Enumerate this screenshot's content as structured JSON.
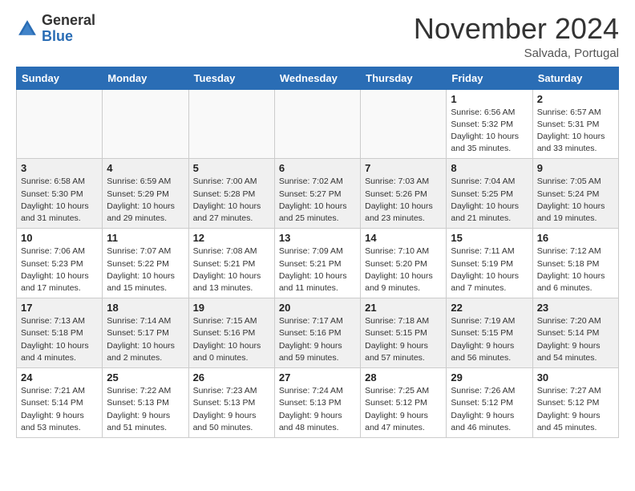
{
  "header": {
    "logo_general": "General",
    "logo_blue": "Blue",
    "month_title": "November 2024",
    "location": "Salvada, Portugal"
  },
  "weekdays": [
    "Sunday",
    "Monday",
    "Tuesday",
    "Wednesday",
    "Thursday",
    "Friday",
    "Saturday"
  ],
  "weeks": [
    [
      {
        "day": "",
        "info": ""
      },
      {
        "day": "",
        "info": ""
      },
      {
        "day": "",
        "info": ""
      },
      {
        "day": "",
        "info": ""
      },
      {
        "day": "",
        "info": ""
      },
      {
        "day": "1",
        "info": "Sunrise: 6:56 AM\nSunset: 5:32 PM\nDaylight: 10 hours\nand 35 minutes."
      },
      {
        "day": "2",
        "info": "Sunrise: 6:57 AM\nSunset: 5:31 PM\nDaylight: 10 hours\nand 33 minutes."
      }
    ],
    [
      {
        "day": "3",
        "info": "Sunrise: 6:58 AM\nSunset: 5:30 PM\nDaylight: 10 hours\nand 31 minutes."
      },
      {
        "day": "4",
        "info": "Sunrise: 6:59 AM\nSunset: 5:29 PM\nDaylight: 10 hours\nand 29 minutes."
      },
      {
        "day": "5",
        "info": "Sunrise: 7:00 AM\nSunset: 5:28 PM\nDaylight: 10 hours\nand 27 minutes."
      },
      {
        "day": "6",
        "info": "Sunrise: 7:02 AM\nSunset: 5:27 PM\nDaylight: 10 hours\nand 25 minutes."
      },
      {
        "day": "7",
        "info": "Sunrise: 7:03 AM\nSunset: 5:26 PM\nDaylight: 10 hours\nand 23 minutes."
      },
      {
        "day": "8",
        "info": "Sunrise: 7:04 AM\nSunset: 5:25 PM\nDaylight: 10 hours\nand 21 minutes."
      },
      {
        "day": "9",
        "info": "Sunrise: 7:05 AM\nSunset: 5:24 PM\nDaylight: 10 hours\nand 19 minutes."
      }
    ],
    [
      {
        "day": "10",
        "info": "Sunrise: 7:06 AM\nSunset: 5:23 PM\nDaylight: 10 hours\nand 17 minutes."
      },
      {
        "day": "11",
        "info": "Sunrise: 7:07 AM\nSunset: 5:22 PM\nDaylight: 10 hours\nand 15 minutes."
      },
      {
        "day": "12",
        "info": "Sunrise: 7:08 AM\nSunset: 5:21 PM\nDaylight: 10 hours\nand 13 minutes."
      },
      {
        "day": "13",
        "info": "Sunrise: 7:09 AM\nSunset: 5:21 PM\nDaylight: 10 hours\nand 11 minutes."
      },
      {
        "day": "14",
        "info": "Sunrise: 7:10 AM\nSunset: 5:20 PM\nDaylight: 10 hours\nand 9 minutes."
      },
      {
        "day": "15",
        "info": "Sunrise: 7:11 AM\nSunset: 5:19 PM\nDaylight: 10 hours\nand 7 minutes."
      },
      {
        "day": "16",
        "info": "Sunrise: 7:12 AM\nSunset: 5:18 PM\nDaylight: 10 hours\nand 6 minutes."
      }
    ],
    [
      {
        "day": "17",
        "info": "Sunrise: 7:13 AM\nSunset: 5:18 PM\nDaylight: 10 hours\nand 4 minutes."
      },
      {
        "day": "18",
        "info": "Sunrise: 7:14 AM\nSunset: 5:17 PM\nDaylight: 10 hours\nand 2 minutes."
      },
      {
        "day": "19",
        "info": "Sunrise: 7:15 AM\nSunset: 5:16 PM\nDaylight: 10 hours\nand 0 minutes."
      },
      {
        "day": "20",
        "info": "Sunrise: 7:17 AM\nSunset: 5:16 PM\nDaylight: 9 hours\nand 59 minutes."
      },
      {
        "day": "21",
        "info": "Sunrise: 7:18 AM\nSunset: 5:15 PM\nDaylight: 9 hours\nand 57 minutes."
      },
      {
        "day": "22",
        "info": "Sunrise: 7:19 AM\nSunset: 5:15 PM\nDaylight: 9 hours\nand 56 minutes."
      },
      {
        "day": "23",
        "info": "Sunrise: 7:20 AM\nSunset: 5:14 PM\nDaylight: 9 hours\nand 54 minutes."
      }
    ],
    [
      {
        "day": "24",
        "info": "Sunrise: 7:21 AM\nSunset: 5:14 PM\nDaylight: 9 hours\nand 53 minutes."
      },
      {
        "day": "25",
        "info": "Sunrise: 7:22 AM\nSunset: 5:13 PM\nDaylight: 9 hours\nand 51 minutes."
      },
      {
        "day": "26",
        "info": "Sunrise: 7:23 AM\nSunset: 5:13 PM\nDaylight: 9 hours\nand 50 minutes."
      },
      {
        "day": "27",
        "info": "Sunrise: 7:24 AM\nSunset: 5:13 PM\nDaylight: 9 hours\nand 48 minutes."
      },
      {
        "day": "28",
        "info": "Sunrise: 7:25 AM\nSunset: 5:12 PM\nDaylight: 9 hours\nand 47 minutes."
      },
      {
        "day": "29",
        "info": "Sunrise: 7:26 AM\nSunset: 5:12 PM\nDaylight: 9 hours\nand 46 minutes."
      },
      {
        "day": "30",
        "info": "Sunrise: 7:27 AM\nSunset: 5:12 PM\nDaylight: 9 hours\nand 45 minutes."
      }
    ]
  ]
}
